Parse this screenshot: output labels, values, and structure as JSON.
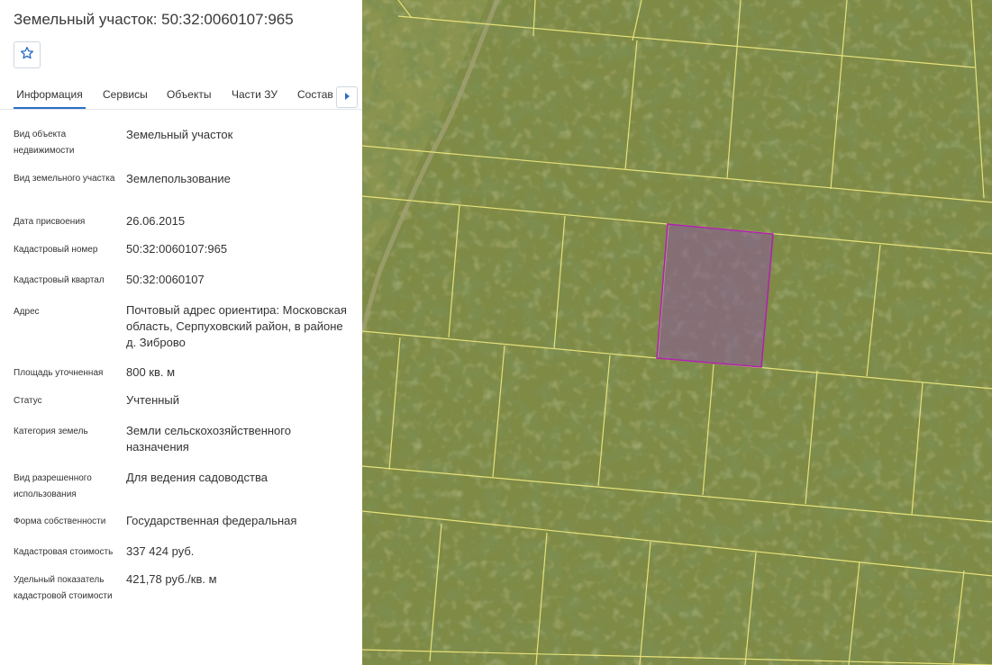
{
  "panel": {
    "title": "Земельный участок: 50:32:0060107:965",
    "favorite_icon": "star-outline-icon",
    "tabs": [
      {
        "label": "Информация",
        "active": true
      },
      {
        "label": "Сервисы",
        "active": false
      },
      {
        "label": "Объекты",
        "active": false
      },
      {
        "label": "Части ЗУ",
        "active": false
      },
      {
        "label": "Состав ЕЗП",
        "active": false
      }
    ],
    "tab_next_icon": "caret-right-icon",
    "fields": [
      {
        "label": "Вид объекта недвижимости",
        "value": "Земельный участок"
      },
      {
        "label": "Вид земельного участка",
        "value": "Землепользование"
      },
      {
        "label": "Дата присвоения",
        "value": "26.06.2015"
      },
      {
        "label": "Кадастровый номер",
        "value": "50:32:0060107:965"
      },
      {
        "label": "Кадастровый квартал",
        "value": "50:32:0060107"
      },
      {
        "label": "Адрес",
        "value": "Почтовый адрес ориентира: Московская область, Серпуховский район, в районе д. Зиброво"
      },
      {
        "label": "Площадь уточненная",
        "value": "800 кв. м"
      },
      {
        "label": "Статус",
        "value": "Учтенный"
      },
      {
        "label": "Категория земель",
        "value": "Земли сельскохозяйственного назначения"
      },
      {
        "label": "Вид разрешенного использования",
        "value": "Для ведения садоводства"
      },
      {
        "label": "Форма собственности",
        "value": "Государственная федеральная"
      },
      {
        "label": "Кадастровая стоимость",
        "value": "337 424 руб."
      },
      {
        "label": "Удельный показатель кадастровой стоимости",
        "value": "421,78 руб./кв. м"
      }
    ]
  },
  "map": {
    "colors": {
      "boundary_lines": "#e6e27a",
      "selected_parcel_stroke": "#b020b0",
      "selected_parcel_fill": "#8a5a9a",
      "field": "#7f8a45",
      "forest": "#4d5e22"
    }
  },
  "colors": {
    "accent": "#2a6ec7",
    "text": "#333333"
  }
}
